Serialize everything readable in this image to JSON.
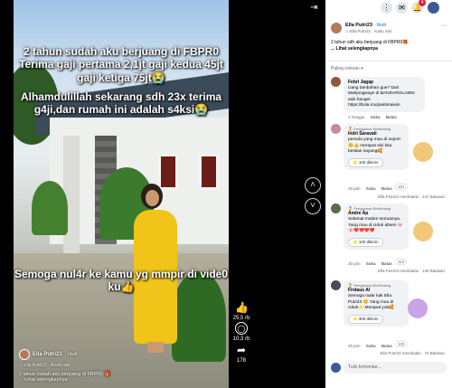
{
  "video": {
    "overlay_top": "2 tahun sudah aku berjuang di FBPR0 Terima gaji pertama 2,1jt gaji kedua 45jt gaji ketiga 75jt😭",
    "overlay_mid": "Alhamdulillah sekarang sdh 23x terima g4ji,dan rumah ini adalah s4ksi😭",
    "overlay_bottom": "Semoga nul4r ke kamu yg mmpir di vide0 ku👍",
    "author": "Ella Putri23",
    "follow": "· Ikuti",
    "audio": "♫ Ella Putri23 · Audio asli",
    "caption": "2 tahun sudah aku berjuang di FBPR0 🎁",
    "see_more": "... Lihat selengkapnya"
  },
  "actions": {
    "likes": "25,5 rb",
    "comments": "10,3 rb",
    "shares": "178"
  },
  "post": {
    "author": "Ella Putri23",
    "follow": "· Ikuti",
    "audio": "♫ Ella Putri23 · Audio asli",
    "caption": "2 tahun sdh aku berjuang di FBPR0🎁",
    "see_more": "... Lihat selengkapnya"
  },
  "sort_label": "Paling relevan ▾",
  "comments": [
    {
      "name": "Febri Jagap",
      "badge": "",
      "text": "Uang tambahan gue? Dari Mahjongways di BANDAROLA88S asik banget https://bola.mx/pastimaiwin",
      "time": "1 minggu",
      "like": "Suka",
      "reply": "Balas",
      "replies": "",
      "reactions": "",
      "gift": ""
    },
    {
      "name": "Indri Saravati",
      "badge": "🏅 Penggemar Berbintang",
      "text": "pemula yang mau di suport 😊👍 merapat sini kita bestian sayang🥰",
      "time": "20 jam",
      "like": "Suka",
      "reply": "Balas",
      "replies": "Ella Putri23 membalas · 147 Balasan",
      "reactions": "161",
      "gift": "⭐ 100 dikirim"
    },
    {
      "name": "Andre Ap",
      "badge": "🏅 Penggemar Berbintang",
      "text": "Selamat malam semuanya. Yang mau di ciduk absen 🌸🌸❤️❤️❤️❤️",
      "time": "20 jam",
      "like": "Suka",
      "reply": "Balas",
      "replies": "Ella Putri23 membalas · 148 Balasan",
      "reactions": "114",
      "gift": "⭐ 100 dikirim"
    },
    {
      "name": "Firdaus Al",
      "badge": "🏅 Penggemar Berbintang",
      "text": "Semoga nular kak Ella Putri23 😊 Yang mau di ciduk⭐ Merapat yuk🥰",
      "time": "20 jam",
      "like": "Suka",
      "reply": "Balas",
      "replies": "Ella Putri23 membalas · 72 Balasan",
      "reactions": "103",
      "gift": "⭐ 300 dikirim"
    }
  ],
  "write_placeholder": "Tulis komentar...",
  "notif_count": "4"
}
